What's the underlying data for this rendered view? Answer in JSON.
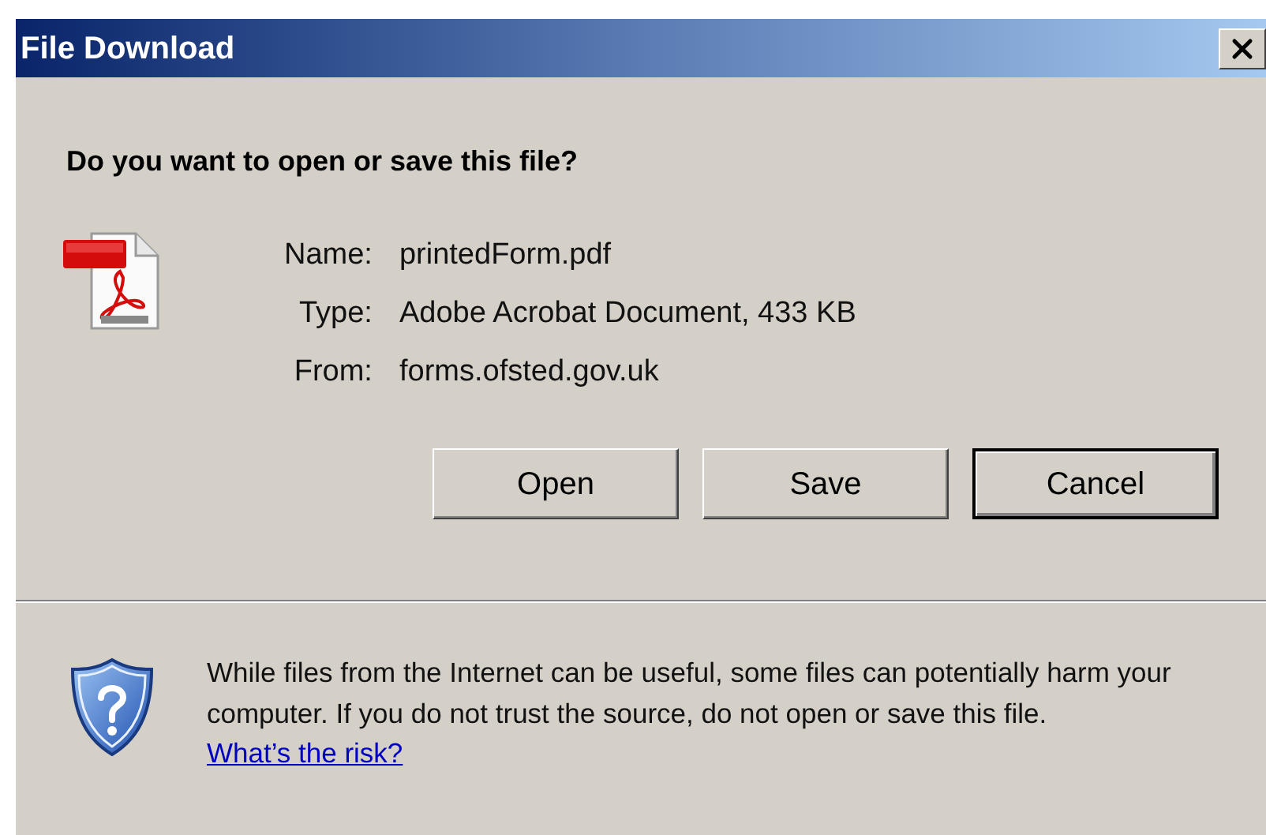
{
  "window": {
    "title": "File Download"
  },
  "question": "Do you want to open or save this file?",
  "details": [
    {
      "label": "Name:",
      "value": "printedForm.pdf"
    },
    {
      "label": "Type:",
      "value": "Adobe Acrobat Document, 433 KB"
    },
    {
      "label": "From:",
      "value": "forms.ofsted.gov.uk"
    }
  ],
  "buttons": [
    {
      "label": "Open",
      "default": false
    },
    {
      "label": "Save",
      "default": false
    },
    {
      "label": "Cancel",
      "default": true
    }
  ],
  "warning": {
    "text": "While files from the Internet can be useful, some files can potentially harm your computer. If you do not trust the source, do not open or save this file.",
    "link": "What’s the risk?"
  }
}
